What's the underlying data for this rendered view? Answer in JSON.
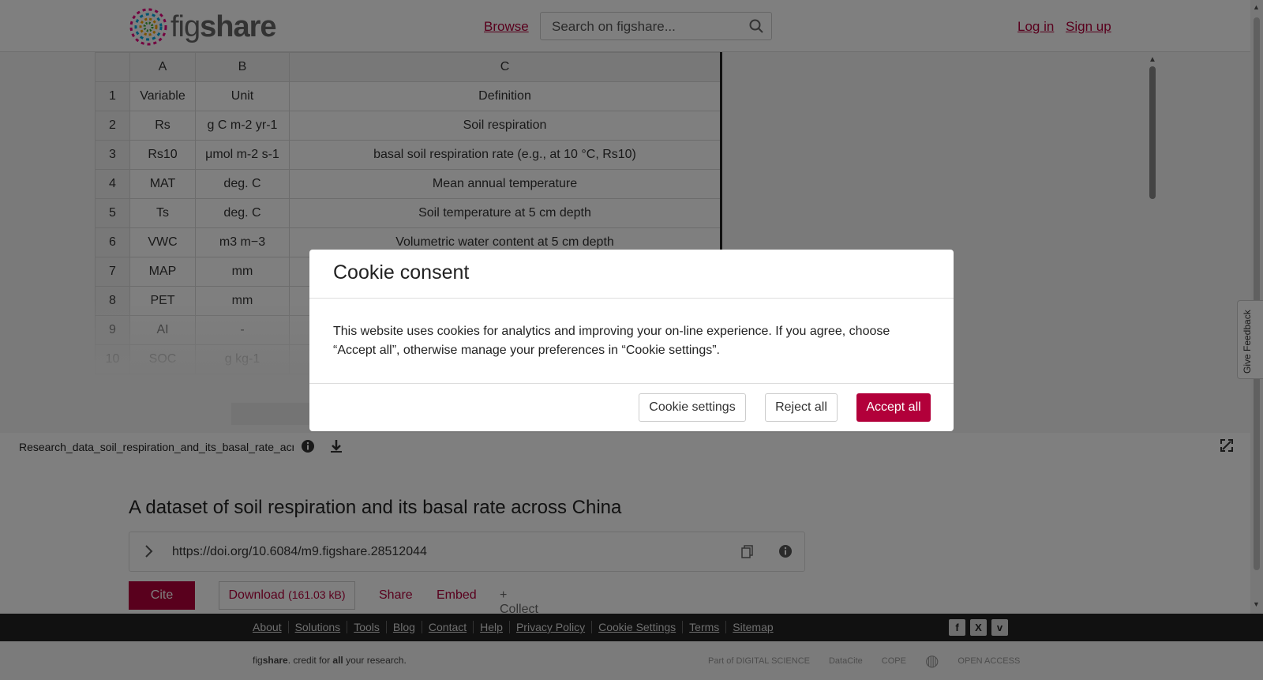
{
  "header": {
    "logo_text_a": "fig",
    "logo_text_b": "share",
    "browse_label": "Browse",
    "search_placeholder": "Search on figshare...",
    "login_label": "Log in",
    "signup_label": "Sign up"
  },
  "sheet": {
    "columns": [
      "A",
      "B",
      "C"
    ],
    "rows": [
      {
        "n": "1",
        "a": "Variable",
        "b": "Unit",
        "c": "Definition"
      },
      {
        "n": "2",
        "a": "Rs",
        "b": "g C m-2 yr-1",
        "c": "Soil respiration"
      },
      {
        "n": "3",
        "a": "Rs10",
        "b": "μmol m-2 s-1",
        "c": "basal soil respiration rate (e.g., at 10 °C, Rs10)"
      },
      {
        "n": "4",
        "a": "MAT",
        "b": "deg. C",
        "c": "Mean annual temperature"
      },
      {
        "n": "5",
        "a": "Ts",
        "b": "deg. C",
        "c": "Soil temperature at 5 cm depth"
      },
      {
        "n": "6",
        "a": "VWC",
        "b": "m3 m−3",
        "c": "Volumetric water content at 5 cm depth"
      },
      {
        "n": "7",
        "a": "MAP",
        "b": "mm",
        "c": ""
      },
      {
        "n": "8",
        "a": "PET",
        "b": "mm",
        "c": ""
      },
      {
        "n": "9",
        "a": "AI",
        "b": "-",
        "c": ""
      },
      {
        "n": "10",
        "a": "SOC",
        "b": "g kg-1",
        "c": ""
      }
    ]
  },
  "file": {
    "name": "Research_data_soil_respiration_and_its_basal_rate_across_China"
  },
  "main": {
    "title": "A dataset of soil respiration and its basal rate across China",
    "doi": "https://doi.org/10.6084/m9.figshare.28512044",
    "cite_label": "Cite",
    "download_label": "Download",
    "download_size": "(161.03 kB)",
    "share_label": "Share",
    "embed_label": "Embed",
    "collect_label": "+ Collect"
  },
  "feedback": {
    "label": "Give Feedback"
  },
  "footer": {
    "links": [
      "About",
      "Solutions",
      "Tools",
      "Blog",
      "Contact",
      "Help",
      "Privacy Policy",
      "Cookie Settings",
      "Terms",
      "Sitemap"
    ],
    "social": [
      "f",
      "X",
      "v"
    ],
    "tagline_fig": "fig",
    "tagline_share": "share",
    "tagline_mid": ". credit for ",
    "tagline_all": "all",
    "tagline_end": " your research.",
    "partners": [
      "Part of DIGITAL SCIENCE",
      "DataCite",
      "COPE",
      "",
      "OPEN ACCESS"
    ]
  },
  "cookie": {
    "title": "Cookie consent",
    "body": "This website uses cookies for analytics and improving your on-line experience. If you agree, choose “Accept all”, otherwise manage your preferences in “Cookie settings”.",
    "settings_label": "Cookie settings",
    "reject_label": "Reject all",
    "accept_label": "Accept all"
  },
  "colors": {
    "brand": "#b2003a",
    "footer_bg": "#222222"
  }
}
